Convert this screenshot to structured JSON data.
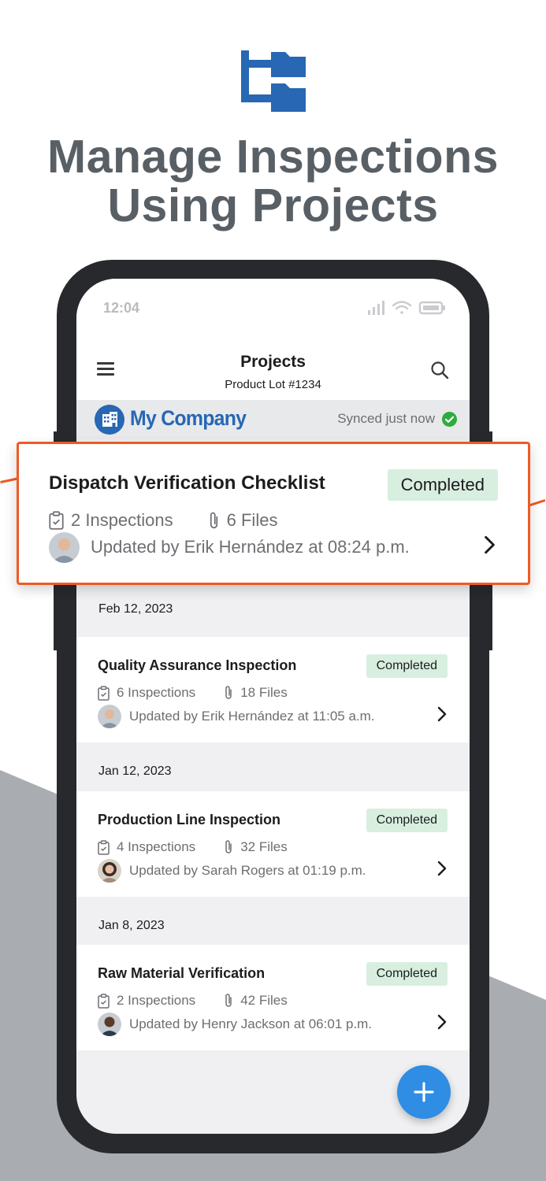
{
  "hero": {
    "title_line1": "Manage Inspections",
    "title_line2": "Using Projects",
    "logo_icon": "folder-tree-icon",
    "title_color": "#585f65"
  },
  "status_bar": {
    "time": "12:04",
    "icons": [
      "signal-icon",
      "wifi-icon",
      "battery-icon"
    ]
  },
  "app_bar": {
    "title": "Projects",
    "subtitle": "Product Lot #1234",
    "menu_icon": "hamburger-icon",
    "search_icon": "search-icon"
  },
  "company": {
    "name": "My Company",
    "sync_status": "Synced just now",
    "brand_color": "#2767b3",
    "sync_color": "#2eab3d"
  },
  "highlight": {
    "title": "Dispatch Verification Checklist",
    "status": "Completed",
    "inspections": "2 Inspections",
    "files": "6 Files",
    "updated": "Updated by Erik Hernández at 08:24 p.m.",
    "accent_color": "#f05a24"
  },
  "projects": [
    {
      "date": "Feb 12, 2023",
      "title": "Quality Assurance Inspection",
      "status": "Completed",
      "inspections": "6 Inspections",
      "files": "18 Files",
      "updated": "Updated by Erik Hernández at 11:05 a.m."
    },
    {
      "date": "Jan 12, 2023",
      "title": "Production Line Inspection",
      "status": "Completed",
      "inspections": "4 Inspections",
      "files": "32 Files",
      "updated": "Updated by Sarah Rogers at 01:19 p.m."
    },
    {
      "date": "Jan 8, 2023",
      "title": "Raw Material Verification",
      "status": "Completed",
      "inspections": "2 Inspections",
      "files": "42 Files",
      "updated": "Updated by Henry Jackson at 06:01 p.m."
    }
  ],
  "fab": {
    "icon": "plus-icon",
    "color": "#2f8de3"
  },
  "badge_color": "#d8efe0"
}
